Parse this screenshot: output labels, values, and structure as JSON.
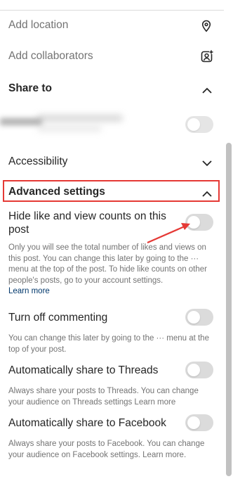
{
  "location": {
    "label": "Add location",
    "icon": "location-pin-icon"
  },
  "collaborators": {
    "label": "Add collaborators",
    "icon": "add-person-icon"
  },
  "share_to": {
    "label": "Share to",
    "icon": "chevron-up-icon"
  },
  "accessibility": {
    "label": "Accessibility",
    "icon": "chevron-down-icon"
  },
  "advanced": {
    "label": "Advanced settings",
    "icon": "chevron-up-icon",
    "highlight_color": "#e53935"
  },
  "hide_counts": {
    "label": "Hide like and view counts on this post",
    "description": "Only you will see the total number of likes and views on this post. You can change this later by going to the ··· menu at the top of the post. To hide like counts on other people's posts, go to your account settings.",
    "link": "Learn more"
  },
  "commenting": {
    "label": "Turn off commenting",
    "description": "You can change this later by going to the ··· menu at the top of your post."
  },
  "threads": {
    "label": "Automatically share to Threads",
    "description": "Always share your posts to Threads. You can change your audience on Threads settings Learn more"
  },
  "facebook": {
    "label": "Automatically share to Facebook",
    "description": "Always share your posts to Facebook. You can change your audience on Facebook settings. Learn more."
  },
  "colors": {
    "toggle_off": "#dbdbdb",
    "arrow": "#e53935"
  }
}
